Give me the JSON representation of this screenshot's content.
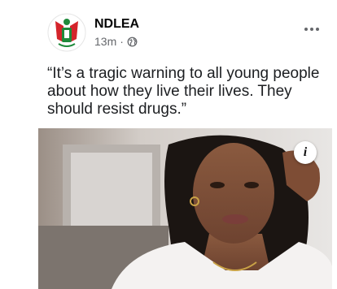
{
  "post": {
    "author": "NDLEA",
    "timestamp": "13m",
    "separator": "·",
    "privacy_icon": "globe-icon",
    "more_icon": "more-horizontal-icon",
    "caption": "“It’s a tragic warning to all young people about how they live their lives. They should resist drugs.”",
    "info_glyph": "i"
  },
  "colors": {
    "text_primary": "#050505",
    "text_secondary": "#65676b",
    "logo_green": "#1f8a3b",
    "logo_red": "#d4242b"
  }
}
